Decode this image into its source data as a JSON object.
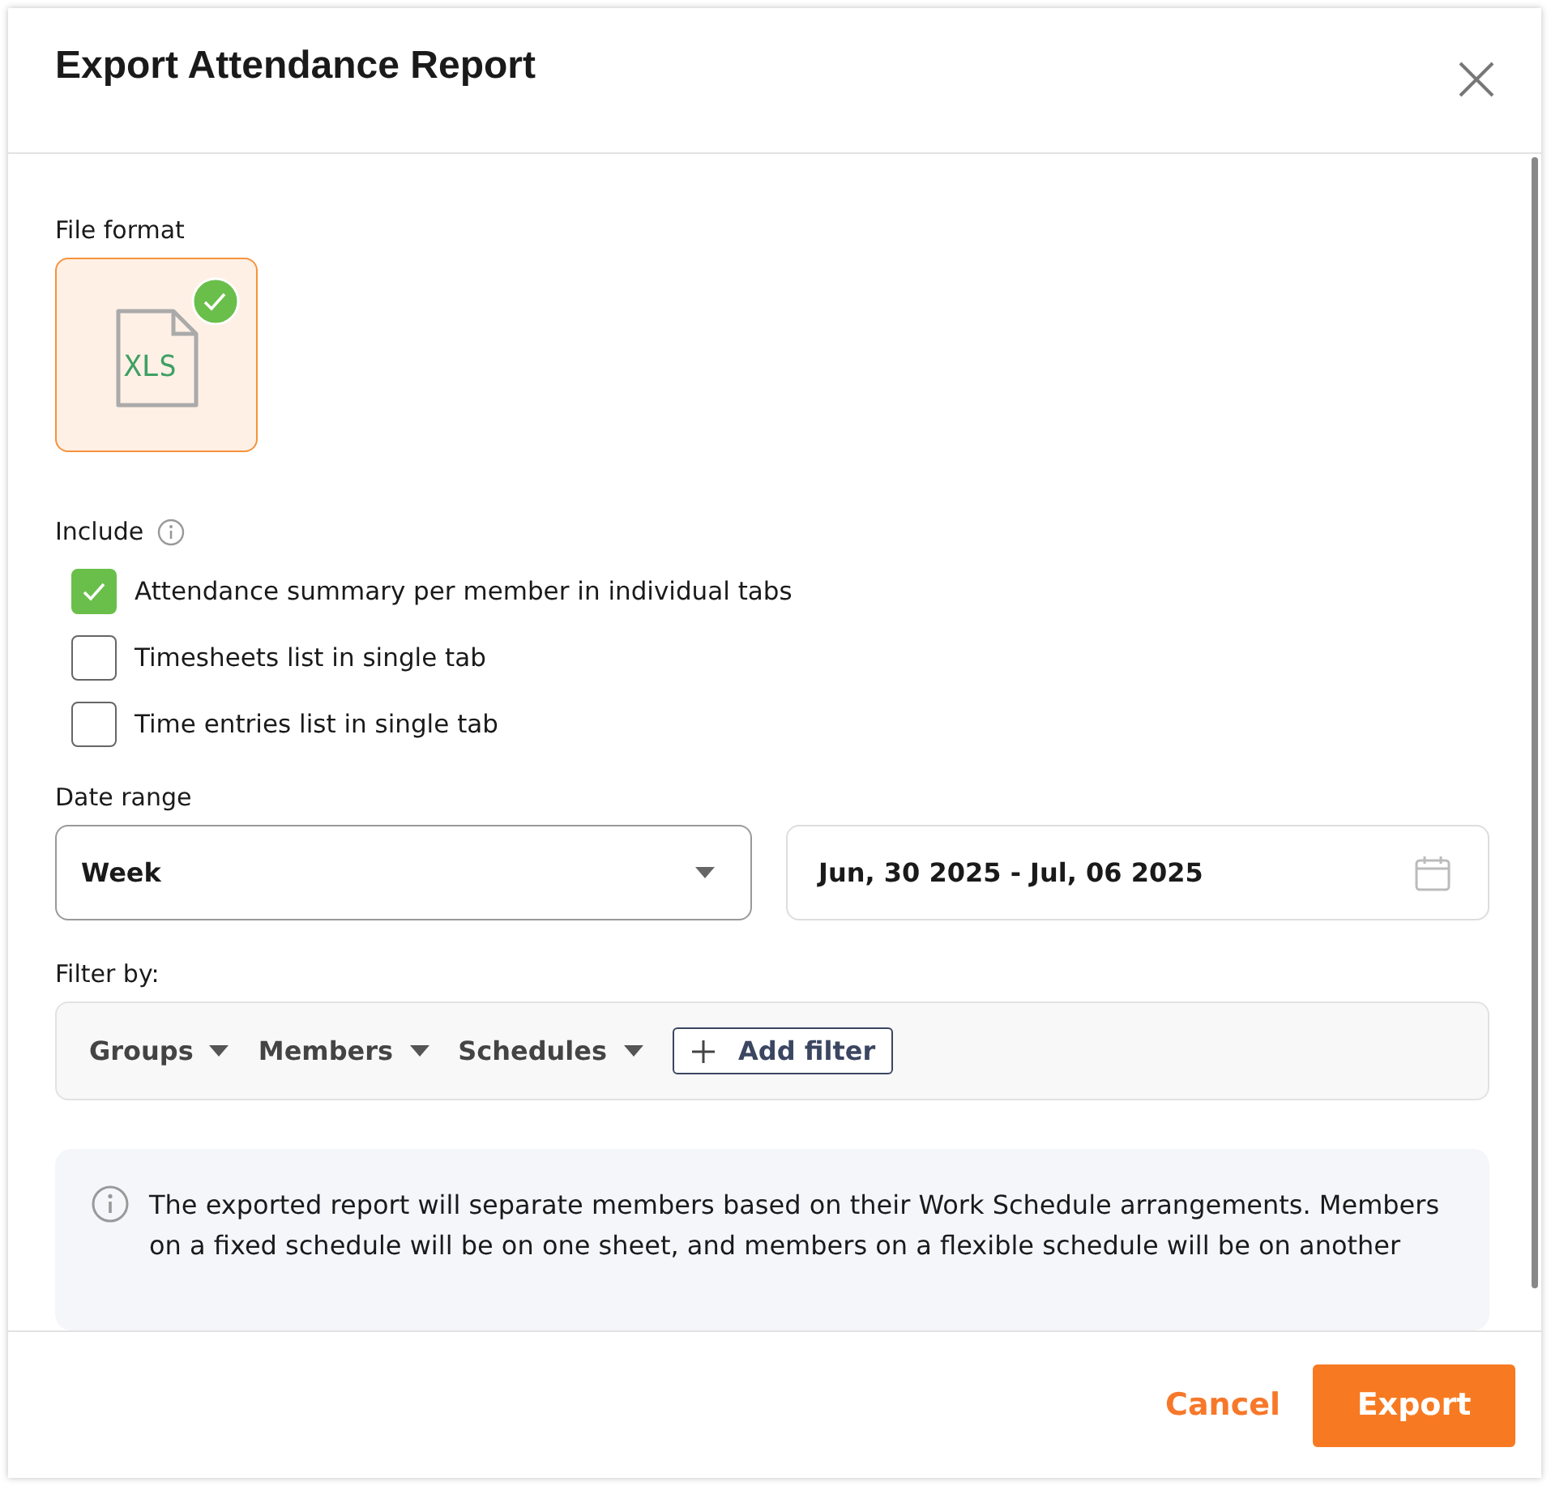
{
  "dialog": {
    "title": "Export Attendance Report"
  },
  "file_format": {
    "label": "File format",
    "options": [
      {
        "label": "XLS",
        "selected": true
      }
    ]
  },
  "include": {
    "label": "Include",
    "options": [
      {
        "label": "Attendance summary per member in individual tabs",
        "checked": true
      },
      {
        "label": "Timesheets list in single tab",
        "checked": false
      },
      {
        "label": "Time entries list in single tab",
        "checked": false
      }
    ]
  },
  "date_range": {
    "label": "Date range",
    "period": "Week",
    "dates": "Jun, 30 2025 - Jul, 06 2025"
  },
  "filter": {
    "label": "Filter by:",
    "dropdowns": [
      "Groups",
      "Members",
      "Schedules"
    ],
    "add_button": "Add filter"
  },
  "notice": "The exported report will separate members based on their Work Schedule arrangements. Members on a fixed schedule will be on one sheet, and members on a flexible schedule will be on another",
  "buttons": {
    "cancel": "Cancel",
    "export": "Export"
  }
}
